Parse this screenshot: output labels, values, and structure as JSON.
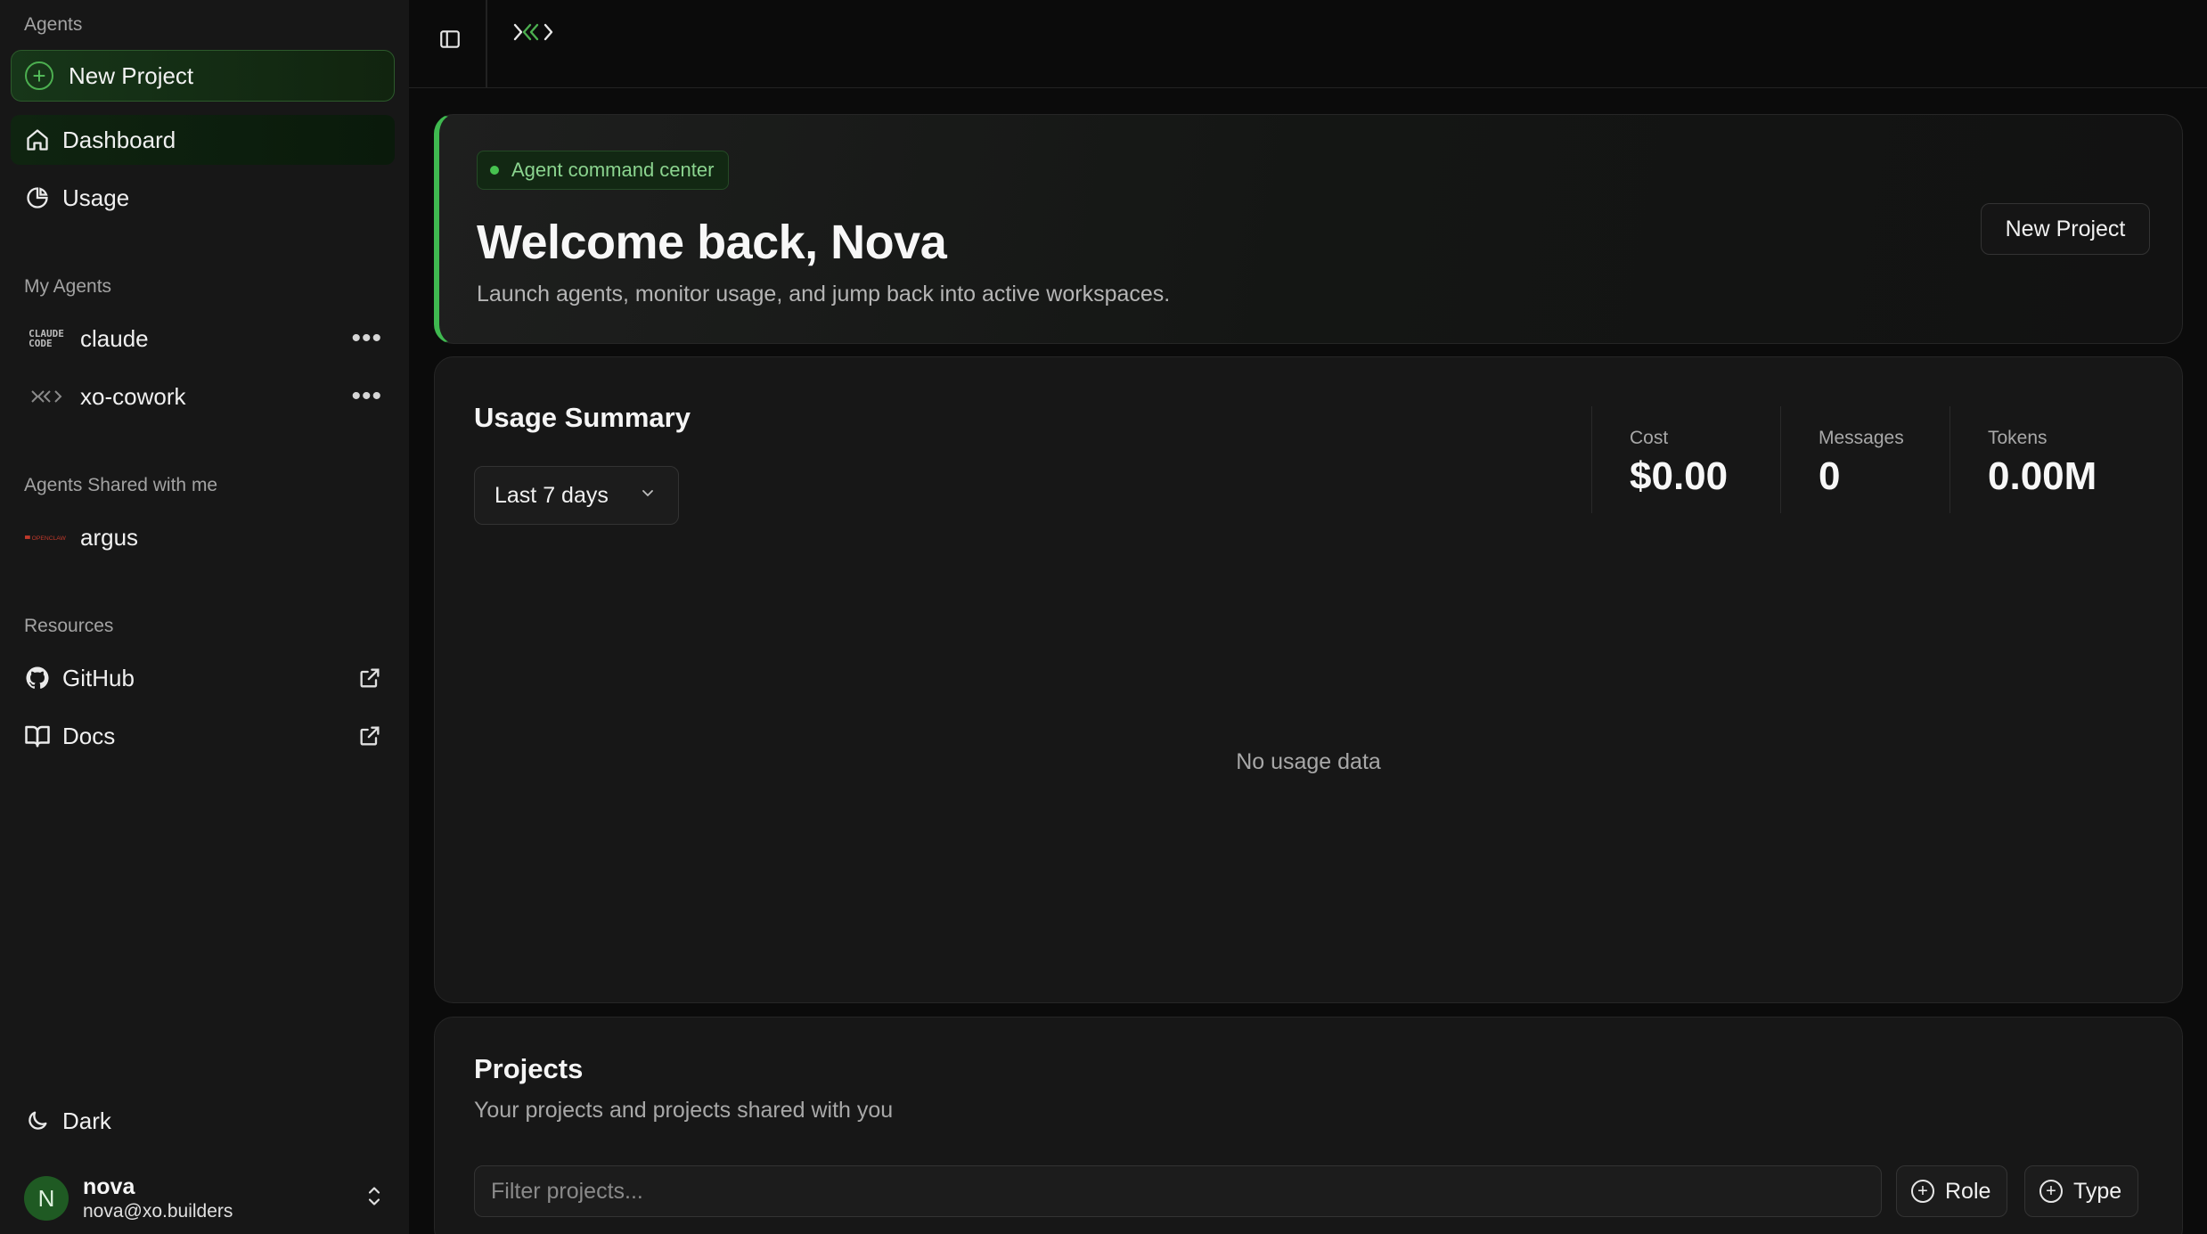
{
  "sidebar": {
    "agents_label": "Agents",
    "new_project_label": "New Project",
    "nav": [
      {
        "label": "Dashboard",
        "icon": "home-icon",
        "active": true
      },
      {
        "label": "Usage",
        "icon": "pie-chart-icon",
        "active": false
      }
    ],
    "my_agents_label": "My Agents",
    "my_agents": [
      {
        "label": "claude",
        "icon": "claude-code-logo-icon",
        "logo_text": "CLAUDE\nCODE"
      },
      {
        "label": "xo-cowork",
        "icon": "xo-logo-icon"
      }
    ],
    "shared_label": "Agents Shared with me",
    "shared_agents": [
      {
        "label": "argus",
        "icon": "openclaw-logo-icon",
        "logo_text": "OPENCLAW"
      }
    ],
    "resources_label": "Resources",
    "resources": [
      {
        "label": "GitHub",
        "icon": "github-icon"
      },
      {
        "label": "Docs",
        "icon": "book-icon"
      }
    ],
    "theme_label": "Dark",
    "user": {
      "initial": "N",
      "name": "nova",
      "email": "nova@xo.builders"
    }
  },
  "hero": {
    "chip": "Agent command center",
    "title": "Welcome back, Nova",
    "subtitle": "Launch agents, monitor usage, and jump back into active workspaces.",
    "button": "New Project"
  },
  "usage": {
    "title": "Usage Summary",
    "range": "Last 7 days",
    "stats": [
      {
        "label": "Cost",
        "value": "$0.00"
      },
      {
        "label": "Messages",
        "value": "0"
      },
      {
        "label": "Tokens",
        "value": "0.00M"
      }
    ],
    "empty": "No usage data"
  },
  "projects": {
    "title": "Projects",
    "subtitle": "Your projects and projects shared with you",
    "filter_placeholder": "Filter projects...",
    "filters": [
      "Role",
      "Type"
    ]
  },
  "colors": {
    "accent": "#3fb950",
    "background": "#0b0b0b",
    "sidebar": "#171717"
  }
}
